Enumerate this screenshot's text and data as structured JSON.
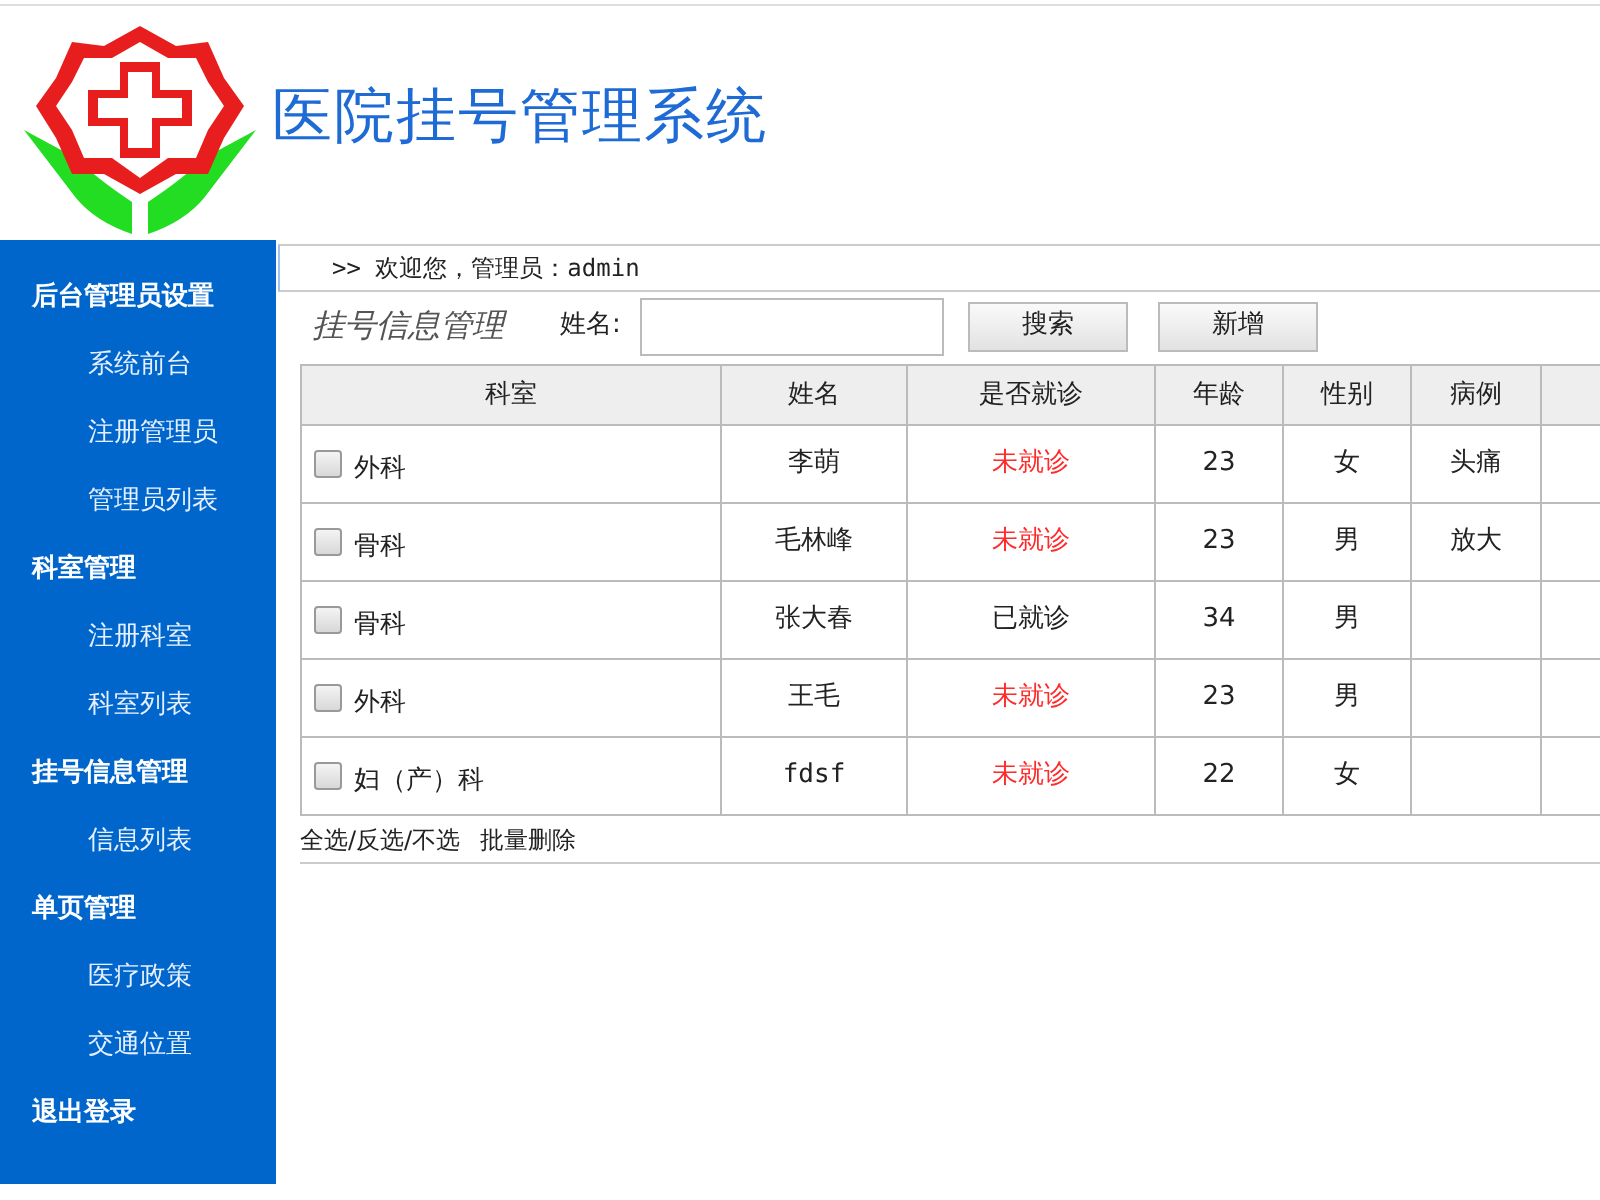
{
  "header": {
    "title": "医院挂号管理系统"
  },
  "sidebar": {
    "sections": [
      {
        "label": "后台管理员设置",
        "children": [
          {
            "label": "系统前台"
          },
          {
            "label": "注册管理员"
          },
          {
            "label": "管理员列表"
          }
        ]
      },
      {
        "label": "科室管理",
        "children": [
          {
            "label": "注册科室"
          },
          {
            "label": "科室列表"
          }
        ]
      },
      {
        "label": "挂号信息管理",
        "children": [
          {
            "label": "信息列表"
          }
        ]
      },
      {
        "label": "单页管理",
        "children": [
          {
            "label": "医疗政策"
          },
          {
            "label": "交通位置"
          }
        ]
      },
      {
        "label": "退出登录"
      }
    ]
  },
  "breadcrumb": ">> 欢迎您，管理员：admin",
  "page_title": "挂号信息管理",
  "search": {
    "label": "姓名:",
    "buttons": [
      "搜索",
      "新增"
    ]
  },
  "table": {
    "columns": [
      "科室",
      "姓名",
      "是否就诊",
      "年龄",
      "性别",
      "病例"
    ],
    "rows": [
      {
        "checked": false,
        "department": "外科",
        "name": "李萌",
        "visit": "未就诊",
        "visited": false,
        "age": "23",
        "sex": "女",
        "case": "头痛"
      },
      {
        "checked": false,
        "department": "骨科",
        "name": "毛林峰",
        "visit": "未就诊",
        "visited": false,
        "age": "23",
        "sex": "男",
        "case": "放大"
      },
      {
        "checked": false,
        "department": "骨科",
        "name": "张大春",
        "visit": "已就诊",
        "visited": true,
        "age": "34",
        "sex": "男"
      },
      {
        "checked": false,
        "department": "外科",
        "name": "王毛",
        "visit": "未就诊",
        "visited": false,
        "age": "23",
        "sex": "男"
      },
      {
        "checked": false,
        "department": "妇（产）科",
        "name": "fdsf",
        "visit": "未就诊",
        "visited": false,
        "age": "22",
        "sex": "女"
      }
    ]
  },
  "footer": {
    "select_links": "全选/反选/不选",
    "batch_delete": "批量删除"
  }
}
